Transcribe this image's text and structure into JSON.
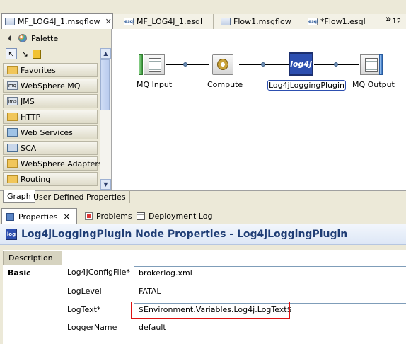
{
  "editor_tabs": [
    {
      "label": "MF_LOG4J_1.msgflow",
      "type": "flow",
      "active": true
    },
    {
      "label": "MF_LOG4J_1.esql",
      "type": "esql",
      "active": false
    },
    {
      "label": "Flow1.msgflow",
      "type": "flow",
      "active": false
    },
    {
      "label": "*Flow1.esql",
      "type": "esql",
      "active": false
    }
  ],
  "tab_overflow": {
    "glyph": "»",
    "count": "12"
  },
  "palette": {
    "title": "Palette",
    "drawers": [
      "Favorites",
      "WebSphere MQ",
      "JMS",
      "HTTP",
      "Web Services",
      "SCA",
      "WebSphere Adapters",
      "Routing"
    ]
  },
  "flow_nodes": [
    {
      "label": "MQ Input",
      "icon": "mq-input-icon"
    },
    {
      "label": "Compute",
      "icon": "compute-icon"
    },
    {
      "label": "Log4jLoggingPlugin",
      "icon": "log4j-icon",
      "icon_text": "log4j"
    },
    {
      "label": "MQ Output",
      "icon": "mq-output-icon"
    }
  ],
  "editor_bottom_tabs": [
    {
      "label": "Graph",
      "active": true
    },
    {
      "label": "User Defined Properties",
      "active": false
    }
  ],
  "view_tabs": [
    {
      "label": "Properties",
      "active": true
    },
    {
      "label": "Problems",
      "active": false
    },
    {
      "label": "Deployment Log",
      "active": false
    }
  ],
  "properties": {
    "title": "Log4jLoggingPlugin Node Properties - Log4jLoggingPlugin",
    "icon_text": "log",
    "sections": [
      "Description",
      "Basic"
    ],
    "selected_section": "Basic",
    "fields": [
      {
        "label": "Log4jConfigFile*",
        "value": "brokerlog.xml"
      },
      {
        "label": "LogLevel",
        "value": "FATAL"
      },
      {
        "label": "LogText*",
        "value": "$Environment.Variables.Log4j.LogText$"
      },
      {
        "label": "LoggerName",
        "value": "default"
      }
    ]
  },
  "colors": {
    "accent": "#1f3d75",
    "highlight_border": "#dd1111"
  }
}
